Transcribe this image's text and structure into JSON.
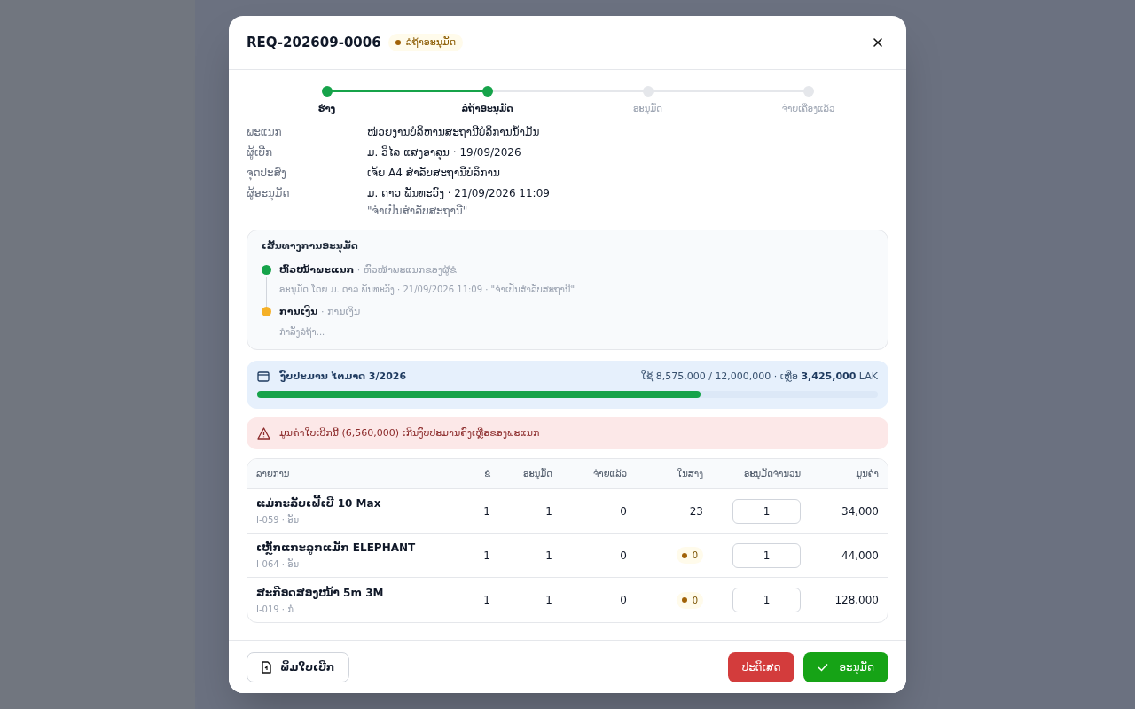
{
  "modal": {
    "title": "REQ-202609-0006",
    "status_badge": "ລໍຖ້າອະນຸມັດ",
    "steps": [
      {
        "label": "ຮ່າງ",
        "completed": true
      },
      {
        "label": "ລໍຖ້າອະນຸມັດ",
        "completed": true
      },
      {
        "label": "ອະນຸມັດ",
        "completed": false
      },
      {
        "label": "ຈ່າຍເຄື່ອງແລ້ວ",
        "completed": false
      }
    ],
    "details": [
      {
        "label": "ພະແນກ",
        "value": "ໜ່ວຍງານບໍລິຫານສະຖານີບໍລິການນ້ຳມັນ"
      },
      {
        "label": "ຜູ້ເບີກ",
        "value": "ມ. ວິໄລ ແສງອາລຸນ · 19/09/2026"
      },
      {
        "label": "ຈຸດປະສົງ",
        "value": "ເຈ້ຍ A4 ສຳລັບສະຖານີບໍລິການ"
      },
      {
        "label": "ຜູ້ອະນຸມັດ",
        "value": "ມ. ດາວ ພັນທະວົງ · 21/09/2026 11:09",
        "note": "\"ຈຳເປັນສຳລັບສະຖານີ\""
      }
    ],
    "approval_path": {
      "title": "ເສັ້ນທາງການອະນຸມັດ",
      "items": [
        {
          "role": "ຫົວໜ້າພະແນກ",
          "subtitle": "· ຫົວໜ້າພະແນກຂອງຜູ້ຂໍ",
          "detail": "ອະນຸມັດ ໂດຍ ມ. ດາວ ພັນທະວົງ · 21/09/2026 11:09 · \"ຈຳເປັນສຳລັບສະຖານີ\"",
          "color": "#16a34a"
        },
        {
          "role": "ການເງິນ",
          "subtitle": "· ການເງິນ",
          "detail": "ກຳລັງລໍຖ້າ...",
          "color": "#f5b027"
        }
      ]
    },
    "budget": {
      "title": "ງົບປະມານ ໄຕມາດ 3/2026",
      "used": "ໃຊ້ 8,575,000 / 12,000,000 · ເຫຼືອ",
      "remaining": "3,425,000",
      "currency": "LAK",
      "level": 0.714
    },
    "warning": "ມູນຄ່າໃບເບີກນີ້ (6,560,000) ເກີນງົບປະມານຄົງເຫຼືອຂອງພະແນກ",
    "table": {
      "columns": [
        "ລາຍການ",
        "ຂໍ",
        "ອະນຸມັດ",
        "ຈ່າຍແລ້ວ",
        "ໃນສາງ",
        "ອະນຸມັດຈຳນວນ",
        "ມູນຄ່າ"
      ],
      "rows": [
        {
          "name": "ແມ່ກະລັບເຟີ້ເບີ 10 Max",
          "code": "I-059 · ອັນ",
          "requested": "1",
          "approved": "1",
          "issued": "0",
          "stock": "23",
          "low_stock": false,
          "approve_qty": "1",
          "value": "34,000"
        },
        {
          "name": "ເຫຼັກແກະລູກແມັກ ELEPHANT",
          "code": "I-064 · ອັນ",
          "requested": "1",
          "approved": "1",
          "issued": "0",
          "stock": "0",
          "low_stock": true,
          "approve_qty": "1",
          "value": "44,000"
        },
        {
          "name": "ສະກ໊ອດສອງໜ້າ 5m 3M",
          "code": "I-019 · ກໍ່",
          "requested": "1",
          "approved": "1",
          "issued": "0",
          "stock": "0",
          "low_stock": true,
          "approve_qty": "1",
          "value": "128,000"
        }
      ]
    },
    "buttons": {
      "print": "ພິມໃບເບີກ",
      "reject": "ປະຕິເສດ",
      "approve": "ອະນຸມັດ"
    }
  }
}
